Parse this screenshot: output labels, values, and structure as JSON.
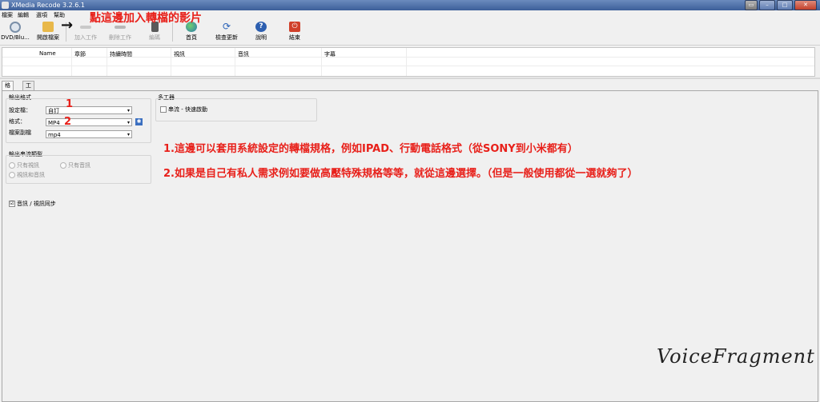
{
  "window": {
    "title": "XMedia Recode 3.2.6.1"
  },
  "menu": [
    "檔案",
    "編輯",
    "選項",
    "幫助"
  ],
  "toolbar": {
    "items": [
      {
        "label": "DVD/Blu...",
        "icon": "disc-icon",
        "color": "#7a8fa8"
      },
      {
        "label": "開啟檔案",
        "icon": "folder-open-icon",
        "color": "#e8b84a"
      },
      {
        "label": "加入工作",
        "icon": "add-job-icon",
        "color": "#b0b0b0"
      },
      {
        "label": "刪除工作",
        "icon": "remove-job-icon",
        "color": "#b0b0b0"
      },
      {
        "label": "編碼",
        "icon": "encode-icon",
        "color": "#555555"
      },
      {
        "label": "首頁",
        "icon": "globe-icon",
        "color": "#2a7ab0"
      },
      {
        "label": "檢查更新",
        "icon": "refresh-icon",
        "color": "#2a62b8"
      },
      {
        "label": "說明",
        "icon": "help-icon",
        "color": "#2d5fb0"
      },
      {
        "label": "結束",
        "icon": "power-icon",
        "color": "#d0402a"
      }
    ]
  },
  "job_table": {
    "columns": [
      "Name",
      "章節",
      "持續時間",
      "視訊",
      "音訊",
      "字幕"
    ]
  },
  "tabs": [
    "格式",
    "工作"
  ],
  "output_format": {
    "group_title": "輸出格式",
    "profile_label": "設定檔：",
    "profile_value": "自訂",
    "format_label": "格式：",
    "format_value": "MP4",
    "ext_label": "檔案副檔",
    "ext_value": "mp4"
  },
  "stream_type": {
    "group_title": "輸出串流類型",
    "options": [
      "只有視訊",
      "只有音訊",
      "視訊和音訊"
    ]
  },
  "av_sync": {
    "label": "音訊 / 視訊同步",
    "checked": "☑"
  },
  "multiplexer": {
    "group_title": "多工器",
    "streaming_label": "串流 - 快速啟動"
  },
  "annotations": {
    "top": "點這邊加入轉檔的影片",
    "num1": "1",
    "num2": "2",
    "line1": "1.這邊可以套用系統設定的轉檔規格，例如IPAD、行動電話格式（從SONY到小米都有）",
    "line2": "2.如果是自己有私人需求例如要做高壓特殊規格等等，就從這邊選擇。（但是一般使用都從一選就夠了）",
    "arrow": "→",
    "accent_color": "#e8201a"
  },
  "watermark": "VoiceFragment"
}
